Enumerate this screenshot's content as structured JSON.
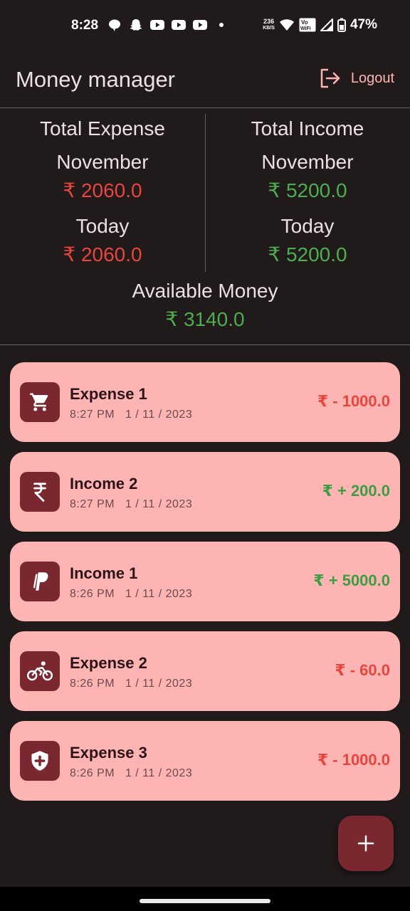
{
  "status_bar": {
    "time": "8:28",
    "speed_value": "236",
    "speed_unit": "KB/S",
    "volte": "Vo WiFi",
    "battery": "47%"
  },
  "app_bar": {
    "title": "Money manager",
    "logout_label": "Logout"
  },
  "summary": {
    "expense": {
      "heading": "Total Expense",
      "month_label": "November",
      "month_amount": "₹ 2060.0",
      "today_label": "Today",
      "today_amount": "₹ 2060.0"
    },
    "income": {
      "heading": "Total Income",
      "month_label": "November",
      "month_amount": "₹ 5200.0",
      "today_label": "Today",
      "today_amount": "₹ 5200.0"
    },
    "available": {
      "label": "Available Money",
      "amount": "₹ 3140.0"
    }
  },
  "transactions": [
    {
      "name": "Expense 1",
      "time": "8:27 PM",
      "date": "1 / 11 / 2023",
      "amount": "₹ - 1000.0",
      "type": "expense",
      "icon": "shopping-cart-icon"
    },
    {
      "name": "Income 2",
      "time": "8:27 PM",
      "date": "1 / 11 / 2023",
      "amount": "₹ + 200.0",
      "type": "income",
      "icon": "rupee-icon"
    },
    {
      "name": "Income 1",
      "time": "8:26 PM",
      "date": "1 / 11 / 2023",
      "amount": "₹ + 5000.0",
      "type": "income",
      "icon": "paypal-icon"
    },
    {
      "name": "Expense 2",
      "time": "8:26 PM",
      "date": "1 / 11 / 2023",
      "amount": "₹ - 60.0",
      "type": "expense",
      "icon": "cyclist-icon"
    },
    {
      "name": "Expense 3",
      "time": "8:26 PM",
      "date": "1 / 11 / 2023",
      "amount": "₹ - 1000.0",
      "type": "expense",
      "icon": "health-shield-icon"
    }
  ],
  "fab": {
    "icon": "plus-icon"
  },
  "colors": {
    "background": "#201a1b",
    "card": "#ffb4b4",
    "accent": "#7a2730",
    "expense": "#e8453c",
    "income": "#4cae4f"
  }
}
